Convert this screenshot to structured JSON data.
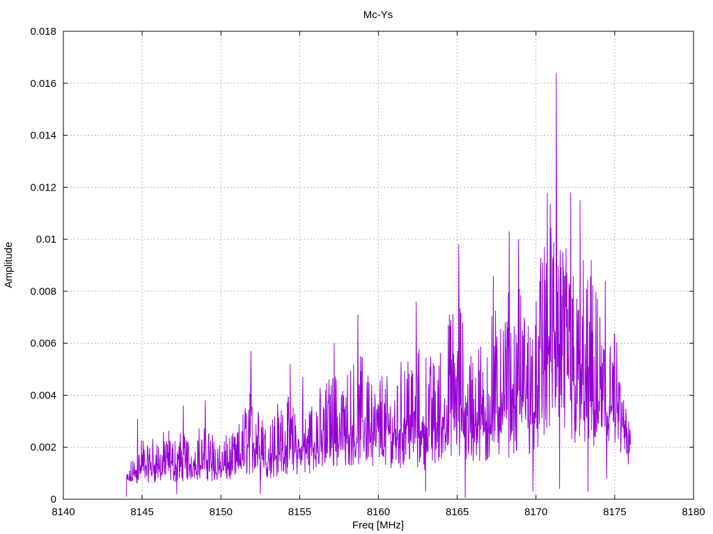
{
  "chart_data": {
    "type": "line",
    "title": "Mc-Ys",
    "xlabel": "Freq [MHz]",
    "ylabel": "Amplitude",
    "xlim": [
      8140,
      8180
    ],
    "ylim": [
      0,
      0.018
    ],
    "x_ticks": [
      "8140",
      "8145",
      "8150",
      "8155",
      "8160",
      "8165",
      "8170",
      "8175",
      "8180"
    ],
    "y_ticks": [
      "0",
      "0.002",
      "0.004",
      "0.006",
      "0.008",
      "0.01",
      "0.012",
      "0.014",
      "0.016",
      "0.018"
    ],
    "grid": true,
    "legend": "none",
    "series": [
      {
        "color": "#9400d3",
        "x_range": [
          8144.0,
          8176.0
        ],
        "envelope": [
          {
            "x": 8144.0,
            "min": 0.0004,
            "max": 0.0013
          },
          {
            "x": 8145.0,
            "min": 0.0003,
            "max": 0.0031
          },
          {
            "x": 8146.0,
            "min": 0.0003,
            "max": 0.003
          },
          {
            "x": 8147.0,
            "min": 0.0002,
            "max": 0.0036
          },
          {
            "x": 8148.0,
            "min": 0.0004,
            "max": 0.003
          },
          {
            "x": 8149.0,
            "min": 0.0003,
            "max": 0.0038
          },
          {
            "x": 8150.0,
            "min": 0.0003,
            "max": 0.0029
          },
          {
            "x": 8151.0,
            "min": 0.0004,
            "max": 0.0032
          },
          {
            "x": 8152.0,
            "min": 0.0003,
            "max": 0.0057
          },
          {
            "x": 8153.0,
            "min": 0.0003,
            "max": 0.004
          },
          {
            "x": 8154.0,
            "min": 0.0003,
            "max": 0.0052
          },
          {
            "x": 8155.0,
            "min": 0.0005,
            "max": 0.004
          },
          {
            "x": 8156.0,
            "min": 0.0005,
            "max": 0.005
          },
          {
            "x": 8157.0,
            "min": 0.0005,
            "max": 0.006
          },
          {
            "x": 8158.0,
            "min": 0.0006,
            "max": 0.0061
          },
          {
            "x": 8159.0,
            "min": 0.0005,
            "max": 0.0071
          },
          {
            "x": 8160.0,
            "min": 0.0006,
            "max": 0.0062
          },
          {
            "x": 8161.0,
            "min": 0.0005,
            "max": 0.0059
          },
          {
            "x": 8162.0,
            "min": 0.0004,
            "max": 0.0076
          },
          {
            "x": 8163.0,
            "min": 0.0003,
            "max": 0.0069
          },
          {
            "x": 8164.0,
            "min": 0.0007,
            "max": 0.0071
          },
          {
            "x": 8165.0,
            "min": 0.0003,
            "max": 0.0098
          },
          {
            "x": 8166.0,
            "min": 0.0003,
            "max": 0.007
          },
          {
            "x": 8167.0,
            "min": 0.0003,
            "max": 0.0086
          },
          {
            "x": 8168.0,
            "min": 0.0004,
            "max": 0.0103
          },
          {
            "x": 8169.0,
            "min": 0.0004,
            "max": 0.01
          },
          {
            "x": 8170.0,
            "min": 0.0007,
            "max": 0.0093
          },
          {
            "x": 8171.0,
            "min": 0.0005,
            "max": 0.0164
          },
          {
            "x": 8172.0,
            "min": 0.0005,
            "max": 0.0118
          },
          {
            "x": 8173.0,
            "min": 0.0006,
            "max": 0.0115
          },
          {
            "x": 8174.0,
            "min": 0.0005,
            "max": 0.0094
          },
          {
            "x": 8175.0,
            "min": 0.0008,
            "max": 0.008
          },
          {
            "x": 8176.0,
            "min": 0.0008,
            "max": 0.0039
          }
        ],
        "peaks": [
          {
            "x": 8144.7,
            "y": 0.0031
          },
          {
            "x": 8147.6,
            "y": 0.0036
          },
          {
            "x": 8149.0,
            "y": 0.0038
          },
          {
            "x": 8151.9,
            "y": 0.0057
          },
          {
            "x": 8154.4,
            "y": 0.0052
          },
          {
            "x": 8155.2,
            "y": 0.0047
          },
          {
            "x": 8157.2,
            "y": 0.006
          },
          {
            "x": 8158.7,
            "y": 0.0071
          },
          {
            "x": 8162.4,
            "y": 0.0076
          },
          {
            "x": 8164.5,
            "y": 0.0071
          },
          {
            "x": 8165.1,
            "y": 0.0098
          },
          {
            "x": 8167.3,
            "y": 0.0086
          },
          {
            "x": 8168.3,
            "y": 0.0103
          },
          {
            "x": 8168.9,
            "y": 0.01
          },
          {
            "x": 8170.3,
            "y": 0.0093
          },
          {
            "x": 8171.3,
            "y": 0.0164
          },
          {
            "x": 8172.2,
            "y": 0.0118
          },
          {
            "x": 8172.8,
            "y": 0.0115
          },
          {
            "x": 8173.5,
            "y": 0.0092
          },
          {
            "x": 8174.4,
            "y": 0.0084
          }
        ],
        "dips": [
          {
            "x": 8144.0,
            "y": 0.0001
          },
          {
            "x": 8147.2,
            "y": 0.0002
          },
          {
            "x": 8152.5,
            "y": 0.0002
          },
          {
            "x": 8163.0,
            "y": 0.0003
          },
          {
            "x": 8165.5,
            "y": 5e-05
          },
          {
            "x": 8169.8,
            "y": 0.0003
          },
          {
            "x": 8171.5,
            "y": 0.0004
          },
          {
            "x": 8173.3,
            "y": 0.0003
          },
          {
            "x": 8174.5,
            "y": 0.0008
          }
        ]
      }
    ]
  }
}
